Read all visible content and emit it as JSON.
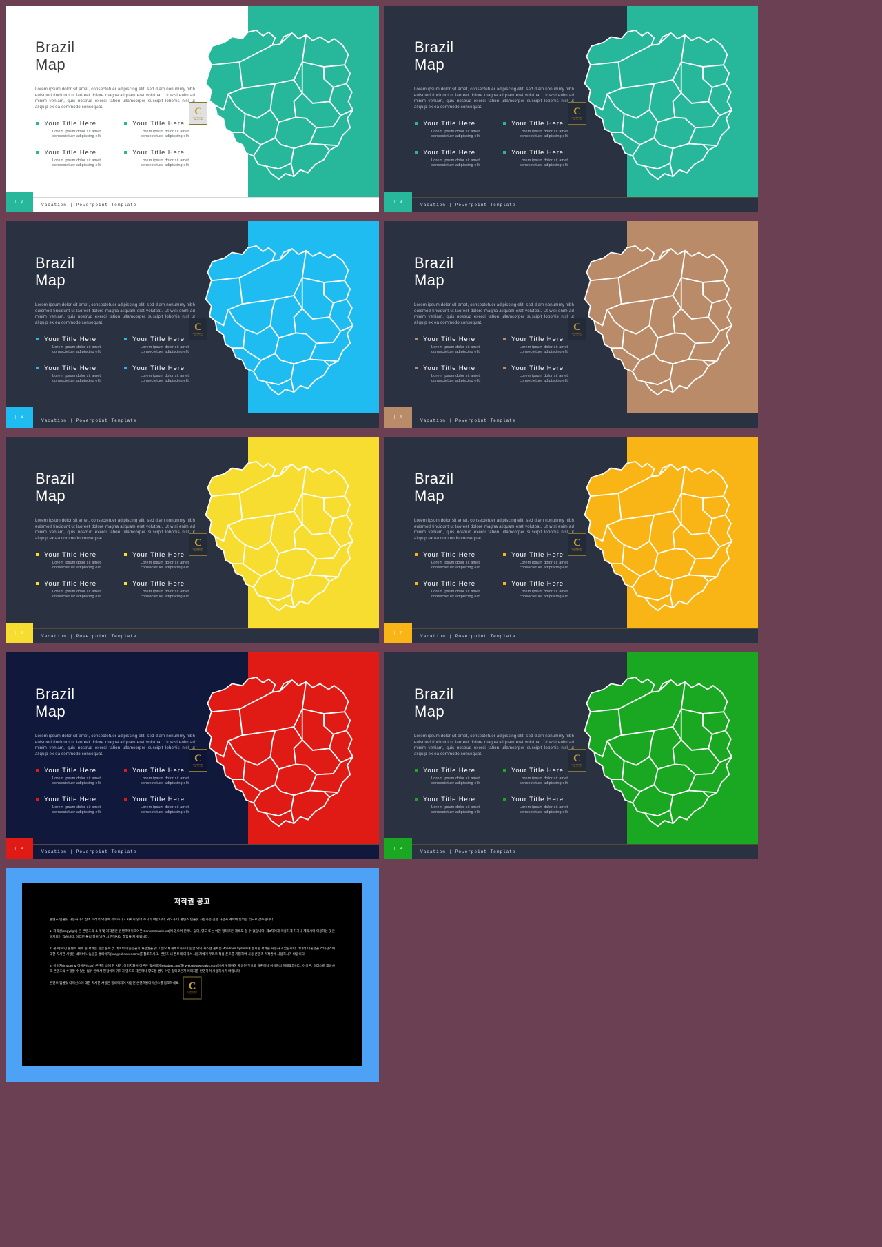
{
  "meta": {
    "page_background": "#6b4052",
    "slide_count": 9
  },
  "common": {
    "title": "Brazil\nMap",
    "paragraph": "Lorem ipsum dolor sit amet, consectetuer adipiscing elit, sed diam nonummy nibh euismod tincidunt ut laoreet dolore magna aliquam erat volutpat. Ut wisi enim ad minim veniam, quis nostrud exerci tation ullamcorper suscipit lobortis nisl ut aliquip ex ea commodo consequat.",
    "bullet_title": "Your Title Here",
    "bullet_sub": "Lorem ipsum dolor sit amet, consectetuer adipiscing elit.",
    "footer_text": "Vacation | Powerpoint Template",
    "watermark": {
      "letter": "C",
      "line1": "CONTENTS",
      "line2": "MALL.COM"
    }
  },
  "slides": [
    {
      "number": "| 2",
      "accent": "#27b79a",
      "bg": "#ffffff",
      "band": "#27b79a",
      "map_fill": "#27b79a",
      "map_stroke": "#ffffff",
      "title_color": "#3b3b3b",
      "text_color": "#5b6066",
      "bullet_title_color": "#3b3b3b",
      "footer_bg": "#ffffff",
      "footer_text_color": "#3b3b3b",
      "footer_line": "#d8d8d8"
    },
    {
      "number": "| 3",
      "accent": "#27b79a",
      "bg": "#2a3140",
      "band": "#27b79a",
      "map_fill": "#27b79a",
      "map_stroke": "#ffffff",
      "title_color": "#ffffff",
      "text_color": "#b9bfc7",
      "bullet_title_color": "#ffffff",
      "footer_bg": "#2a3140",
      "footer_text_color": "#d8dce2",
      "footer_line": "#57493a"
    },
    {
      "number": "| 4",
      "accent": "#1fbcf2",
      "bg": "#2a3140",
      "band": "#1fbcf2",
      "map_fill": "#1fbcf2",
      "map_stroke": "#ffffff",
      "title_color": "#ffffff",
      "text_color": "#b9bfc7",
      "bullet_title_color": "#ffffff",
      "footer_bg": "#2a3140",
      "footer_text_color": "#d8dce2",
      "footer_line": "#57493a"
    },
    {
      "number": "| 5",
      "accent": "#b98b68",
      "bg": "#2a3140",
      "band": "#b98b68",
      "map_fill": "#b98b68",
      "map_stroke": "#ffffff",
      "title_color": "#ffffff",
      "text_color": "#b9bfc7",
      "bullet_title_color": "#ffffff",
      "footer_bg": "#2a3140",
      "footer_text_color": "#d8dce2",
      "footer_line": "#57493a"
    },
    {
      "number": "| 6",
      "accent": "#f7dd2f",
      "bg": "#2a3140",
      "band": "#f7dd2f",
      "map_fill": "#f7dd2f",
      "map_stroke": "#ffffff",
      "title_color": "#ffffff",
      "text_color": "#b9bfc7",
      "bullet_title_color": "#ffffff",
      "footer_bg": "#2a3140",
      "footer_text_color": "#d8dce2",
      "footer_line": "#57493a"
    },
    {
      "number": "| 7",
      "accent": "#f9b515",
      "bg": "#2a3140",
      "band": "#f9b515",
      "map_fill": "#f9b515",
      "map_stroke": "#ffffff",
      "title_color": "#ffffff",
      "text_color": "#b9bfc7",
      "bullet_title_color": "#ffffff",
      "footer_bg": "#2a3140",
      "footer_text_color": "#d8dce2",
      "footer_line": "#57493a"
    },
    {
      "number": "| 8",
      "accent": "#e01b16",
      "bg": "#10193c",
      "band": "#e01b16",
      "map_fill": "#e01b16",
      "map_stroke": "#ffffff",
      "title_color": "#ffffff",
      "text_color": "#b9bfc7",
      "bullet_title_color": "#ffffff",
      "footer_bg": "#10193c",
      "footer_text_color": "#d8dce2",
      "footer_line": "#57493a"
    },
    {
      "number": "| 9",
      "accent": "#1aa823",
      "bg": "#2a3140",
      "band": "#1aa823",
      "map_fill": "#1aa823",
      "map_stroke": "#ffffff",
      "title_color": "#ffffff",
      "text_color": "#b9bfc7",
      "bullet_title_color": "#ffffff",
      "footer_bg": "#2a3140",
      "footer_text_color": "#d8dce2",
      "footer_line": "#57493a"
    }
  ],
  "copyright": {
    "frame_color": "#4da2f5",
    "title": "저작권 공고",
    "intro": "콘텐츠 템플릿 사용하시기 전에 아래의 약관에 유의하시고 자세히 읽어 주시기 바랍니다. 귀하가 이 콘텐츠 템플릿 사용하는 것은 사용자 계약에 동의한 것으로 간주됩니다.",
    "clauses": [
      "1. 저작권(copyright) 본 콘텐츠의 소유 및 저작권은 콘텐츠메이크어웃(Contentsmakeout)에 있으며 판매나 임대, 양도 또는 어떤 형태로든 재배포 할 수 없습니다. 제3자에게 이용하게 하거나 제작시에 이용하는 것은 금지되어 있습니다. 이러한 불법 행위 발견 시 민형사상 책임을 지게 됩니다.",
      "2. 폰트(font) 콘텐츠 내에 된 서체는 한글 폰트 및 네이버 나눔글꼴의 사용권을 갖고 있으며 재배포하거나 한글 외의 시스템 폰트는 Windows System에 설치된 서체를 사용하고 있습니다. 네이버 나눔글꼴 라이선스에 대한 자세한 사항은 네이버 나눔글꼴 홈페이지(hangeul.naver.com)를 참조하세요. 콘텐츠 내 폰트에 대해서 사용자에게 무료로 적용 폰트를 기입하여 사용 콘텐츠 저작권에 사용하시기 바랍니다.",
      "3. 이미지(image) & 아이콘(icon) 콘텐츠 내에 된 사진, 이미지와 아이콘은 픽사베이(pixabay.com)와 Webalys(webalys.com)에서 구매하여 제공된 것으로 재판매나 이용자의 재배포입니다. 아이콘, 일러스트 제공사로 콘텐츠의 수정할 수 있는 범위 안에서 편집이며 귀하가 별도로 재판매나 양도할 경우 어떤 형태로든지 이미지를 반영하여 사용하시기 바랍니다.",
      "콘텐츠 템플릿 라이선스에 대한 자세한 사항은 홈페이지에 사용된 콘텐츠몰라이선스를 참조하세요."
    ]
  }
}
